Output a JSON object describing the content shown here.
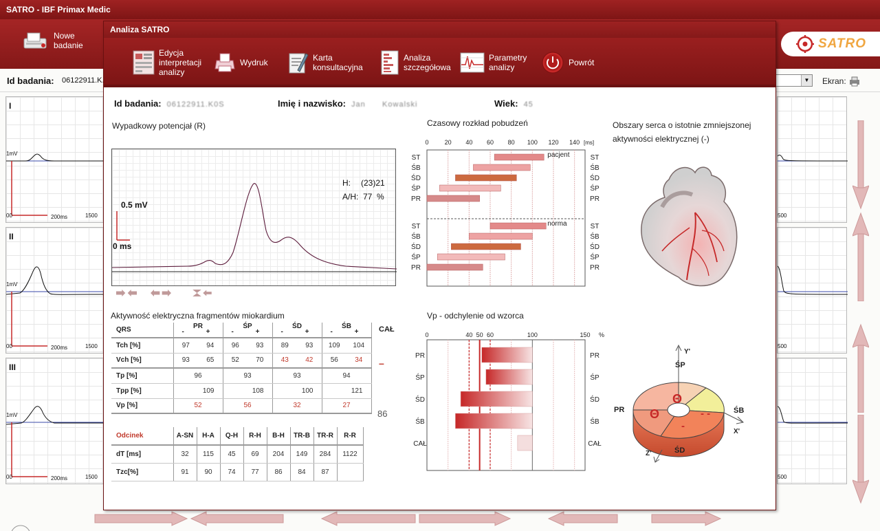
{
  "app": {
    "title": "SATRO - IBF Primax Medic",
    "new_exam_label": "Nowe\nbadanie",
    "logo_text": "SATRO",
    "id_label": "Id badania:",
    "id_value": "06122911.K...",
    "screen_label": "Ekran:"
  },
  "leads": [
    {
      "name": "I",
      "mv": "1mV",
      "ms": "200ms",
      "end": "1500",
      "origin": "00"
    },
    {
      "name": "II",
      "mv": "1mV",
      "ms": "200ms",
      "end": "1500",
      "origin": "00"
    },
    {
      "name": "III",
      "mv": "1mV",
      "ms": "200ms",
      "end": "1500",
      "origin": "00"
    }
  ],
  "right_lead_label": "500",
  "modal": {
    "title": "Analiza SATRO",
    "toolbar": [
      {
        "label": "Edycja\ninterpretacji\nanalizy",
        "icon": "edit-interpretation-icon"
      },
      {
        "label": "Wydruk",
        "icon": "printer-icon"
      },
      {
        "label": "Karta\nkonsultacyjna",
        "icon": "consult-card-icon"
      },
      {
        "label": "Analiza\nszczegółowa",
        "icon": "detail-analysis-icon"
      },
      {
        "label": "Parametry\nanalizy",
        "icon": "parameters-icon"
      },
      {
        "label": "Powrót",
        "icon": "power-icon"
      }
    ],
    "patient": {
      "id_label": "Id badania:",
      "id_value": "06122911.K0S",
      "name_label": "Imię i nazwisko:",
      "name_value": "Jan      Kowalski",
      "age_label": "Wiek:",
      "age_value": "45"
    }
  },
  "potential": {
    "title": "Wypadkowy potencjał (R)",
    "scale_mv": "0.5 mV",
    "scale_ms": "0 ms",
    "h_label": "H:",
    "h_value": "(23)21",
    "ah_label": "A/H:",
    "ah_value": "77  %"
  },
  "time_dist": {
    "title": "Czasowy rozkład pobudzeń",
    "unit": "[ms]",
    "ticks": [
      "0",
      "20",
      "40",
      "60",
      "80",
      "100",
      "120",
      "140"
    ],
    "rows": [
      "ST",
      "ŚB",
      "ŚD",
      "ŚP",
      "PR"
    ],
    "patient_label": "pacjent",
    "norm_label": "norma",
    "patient": [
      [
        64,
        111
      ],
      [
        44,
        98
      ],
      [
        27,
        85
      ],
      [
        12,
        70
      ],
      [
        0,
        50
      ]
    ],
    "norm": [
      [
        60,
        113
      ],
      [
        40,
        100
      ],
      [
        23,
        89
      ],
      [
        10,
        74
      ],
      [
        0,
        53
      ]
    ],
    "colors": [
      "#e38989",
      "#eda3a3",
      "#cc6a3f",
      "#f2baba",
      "#d68a8a"
    ]
  },
  "heart": {
    "title": "Obszary serca o istotnie zmniejszonej aktywności elektrycznej (-)"
  },
  "activity": {
    "title": "Aktywność elektryczna fragmentów miokardium",
    "cal_label": "CAŁ",
    "cal_mark": "–",
    "cal_vp": "86",
    "groups": [
      "PR",
      "ŚP",
      "ŚD",
      "ŚB"
    ],
    "minus": "-",
    "plus": "+",
    "qrs_label": "QRS",
    "tch_label": "Tch [%]",
    "tch": [
      "97",
      "94",
      "96",
      "93",
      "89",
      "93",
      "109",
      "104"
    ],
    "vch_label": "Vch [%]",
    "vch": [
      "93",
      "65",
      "52",
      "70",
      "43",
      "42",
      "56",
      "34"
    ],
    "tp_label": "Tp [%]",
    "tp": [
      "96",
      "93",
      "93",
      "94"
    ],
    "tpp_label": "Tpp [%]",
    "tpp": [
      "109",
      "108",
      "100",
      "121"
    ],
    "vp_label": "Vp [%]",
    "vp": [
      "52",
      "56",
      "32",
      "27"
    ]
  },
  "segments": {
    "header_label": "Odcinek",
    "names": [
      "A-SN",
      "H-A",
      "Q-H",
      "R-H",
      "B-H",
      "TR-B",
      "TR-R",
      "R-R"
    ],
    "dt_label": "dT [ms]",
    "dt": [
      "32",
      "115",
      "45",
      "69",
      "204",
      "149",
      "284",
      "1122"
    ],
    "tzc_label": "Tzc[%]",
    "tzc": [
      "91",
      "90",
      "74",
      "77",
      "86",
      "84",
      "87",
      ""
    ]
  },
  "vp_chart": {
    "title": "Vp - odchylenie od wzorca",
    "ticks": [
      "0",
      "40",
      "50",
      "60",
      "100",
      "150",
      "%"
    ],
    "rows": [
      "PR",
      "ŚP",
      "ŚD",
      "ŚB",
      "CAŁ"
    ],
    "values": [
      52,
      56,
      32,
      27,
      86
    ]
  },
  "sectors": {
    "labels": {
      "top": "ŚP",
      "left": "PR",
      "right": "ŚB",
      "bottom": "ŚD",
      "y": "Y'",
      "x": "X'",
      "z": "Z'"
    },
    "marks": {
      "top": "Θ",
      "left": "Θ",
      "right": "- -",
      "bottom": "-"
    }
  }
}
